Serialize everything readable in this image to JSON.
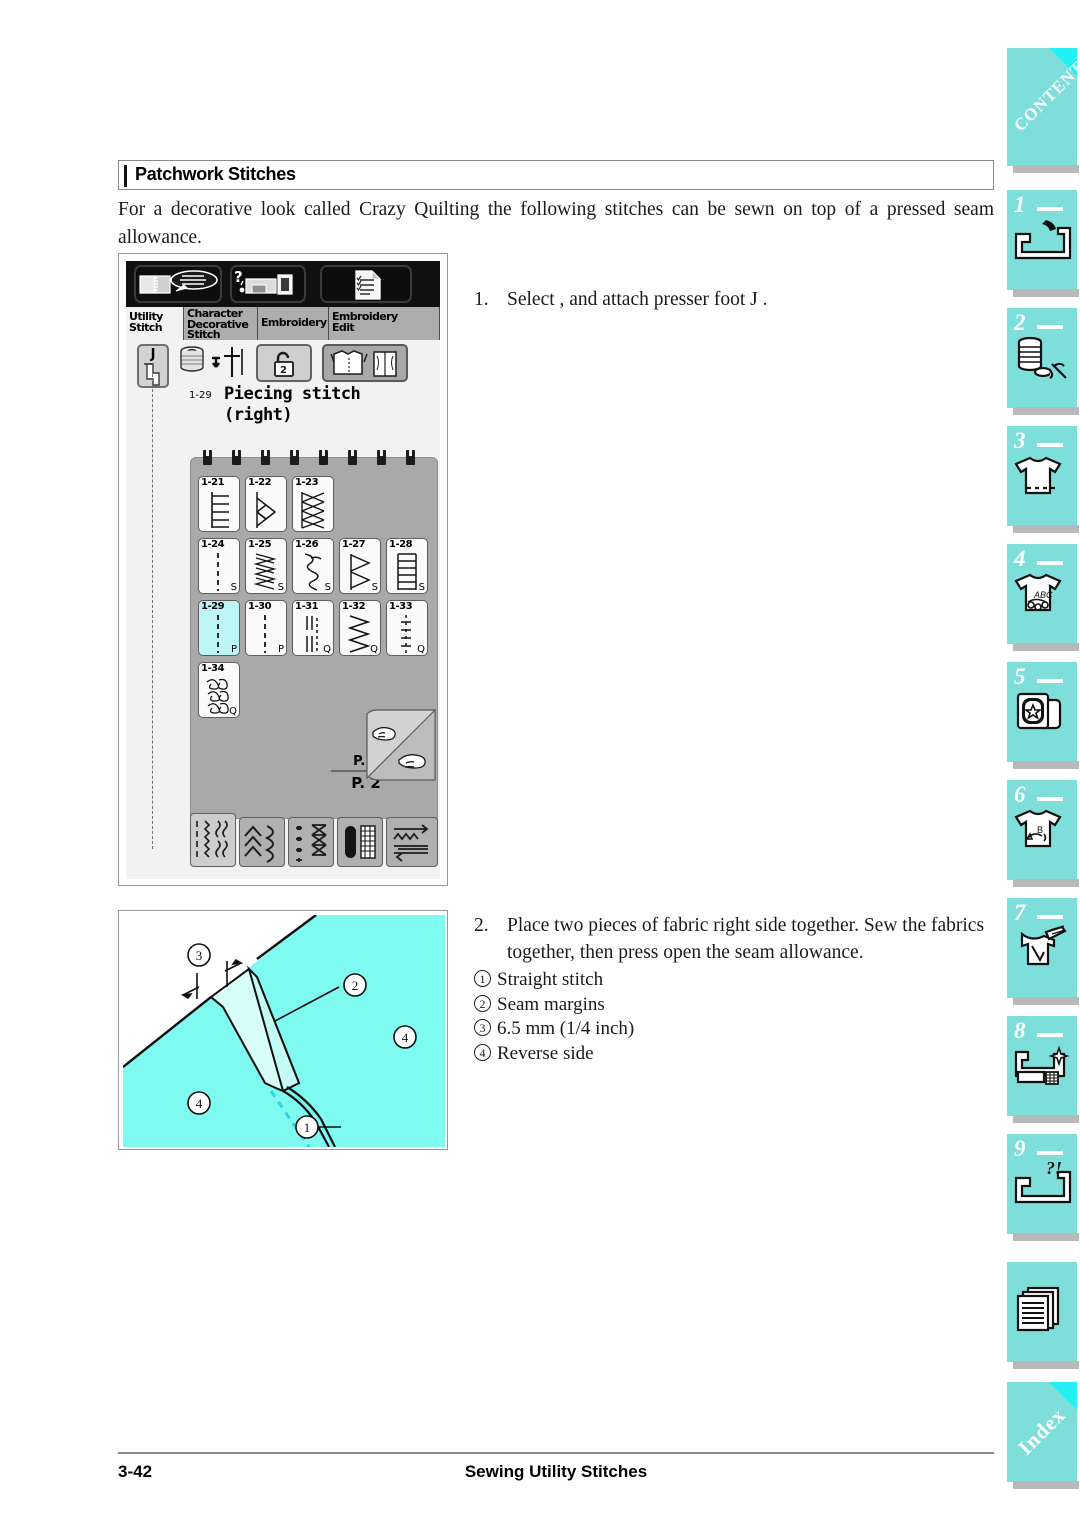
{
  "section": {
    "title": "Patchwork Stitches",
    "intro": "For a decorative look called  Crazy Quilting  the following stitches can be sewn on top of a pressed seam allowance."
  },
  "steps": [
    {
      "number": "1.",
      "text": "Select      , and attach presser foot  J ."
    },
    {
      "number": "2.",
      "text": "Place two pieces of fabric right side together. Sew the fabrics together, then press open the seam allowance.",
      "callouts": [
        {
          "marker": "1",
          "label": "Straight stitch"
        },
        {
          "marker": "2",
          "label": "Seam margins"
        },
        {
          "marker": "3",
          "label": "6.5 mm (1/4 inch)"
        },
        {
          "marker": "4",
          "label": "Reverse side"
        }
      ]
    }
  ],
  "lcd": {
    "toolbar": [
      {
        "name": "manual-guide-icon"
      },
      {
        "name": "machine-help-icon"
      },
      {
        "name": "settings-list-icon"
      }
    ],
    "tabs": [
      {
        "label": "Utility\nStitch",
        "active": true
      },
      {
        "label": "Character\nDecorative\nStitch",
        "active": false
      },
      {
        "label": "Embroidery",
        "active": false
      },
      {
        "label": "Embroidery\nEdit",
        "active": false
      }
    ],
    "presser_foot": "J",
    "stitch_number": "1-29",
    "stitch_name": "Piecing stitch\n(right)",
    "page_indicator_current": "P. 2",
    "page_indicator_total": "P. 2",
    "selected_cell": "1-29",
    "grid": [
      [
        {
          "code": "1-21",
          "suffix": "",
          "glyph": "ladder-bar"
        },
        {
          "code": "1-22",
          "suffix": "",
          "glyph": "diamond-chain"
        },
        {
          "code": "1-23",
          "suffix": "",
          "glyph": "cross-lattice"
        }
      ],
      [
        {
          "code": "1-24",
          "suffix": "S",
          "glyph": "dashed-straight"
        },
        {
          "code": "1-25",
          "suffix": "S",
          "glyph": "zigzag-dense"
        },
        {
          "code": "1-26",
          "suffix": "S",
          "glyph": "wavy-hook"
        },
        {
          "code": "1-27",
          "suffix": "S",
          "glyph": "triangle-row"
        },
        {
          "code": "1-28",
          "suffix": "S",
          "glyph": "ladder-rungs"
        }
      ],
      [
        {
          "code": "1-29",
          "suffix": "P",
          "glyph": "dashed-straight"
        },
        {
          "code": "1-30",
          "suffix": "P",
          "glyph": "dashed-straight"
        },
        {
          "code": "1-31",
          "suffix": "Q",
          "glyph": "double-line"
        },
        {
          "code": "1-32",
          "suffix": "Q",
          "glyph": "zigzag-wide"
        },
        {
          "code": "1-33",
          "suffix": "Q",
          "glyph": "dotted-cross"
        }
      ],
      [
        {
          "code": "1-34",
          "suffix": "Q",
          "glyph": "stipple-scribble"
        }
      ]
    ],
    "category_buttons": [
      {
        "name": "category-utility-stitch",
        "active": true
      },
      {
        "name": "category-decorative-stitch",
        "active": false
      },
      {
        "name": "category-satin-stitch",
        "active": false
      },
      {
        "name": "category-buttonhole",
        "active": false
      },
      {
        "name": "category-feed-direction",
        "active": false
      }
    ]
  },
  "illustration": {
    "markers": [
      "3",
      "2",
      "4",
      "4",
      "1"
    ],
    "fabric_color": "#7ffaf0",
    "fold_color": "#d6fdf8"
  },
  "sidebar": [
    {
      "kind": "label",
      "label": "CONTENTS",
      "name": "sidebar-tab-contents"
    },
    {
      "kind": "numbered",
      "index": "1",
      "name": "sidebar-tab-1-sewing-machine"
    },
    {
      "kind": "numbered",
      "index": "2",
      "name": "sidebar-tab-2-thread-bobbin"
    },
    {
      "kind": "numbered",
      "index": "3",
      "name": "sidebar-tab-3-utility-stitch"
    },
    {
      "kind": "numbered",
      "index": "4",
      "name": "sidebar-tab-4-character-stitch"
    },
    {
      "kind": "numbered",
      "index": "5",
      "name": "sidebar-tab-5-embroidery"
    },
    {
      "kind": "numbered",
      "index": "6",
      "name": "sidebar-tab-6-embroidery-edit"
    },
    {
      "kind": "numbered",
      "index": "7",
      "name": "sidebar-tab-7-customizing"
    },
    {
      "kind": "numbered",
      "index": "8",
      "name": "sidebar-tab-8-maintenance"
    },
    {
      "kind": "numbered",
      "index": "9",
      "name": "sidebar-tab-9-troubleshooting"
    },
    {
      "kind": "icon",
      "name": "sidebar-tab-appendix"
    },
    {
      "kind": "label",
      "label": "Index",
      "name": "sidebar-tab-index"
    }
  ],
  "footer": {
    "page": "3-42",
    "title": "Sewing Utility Stitches"
  },
  "colors": {
    "sidebar_teal": "#7ededa",
    "sidebar_corner": "#22f0f5",
    "selected_cell": "#bdf5f7",
    "fabric_cyan": "#7ffaf0"
  }
}
